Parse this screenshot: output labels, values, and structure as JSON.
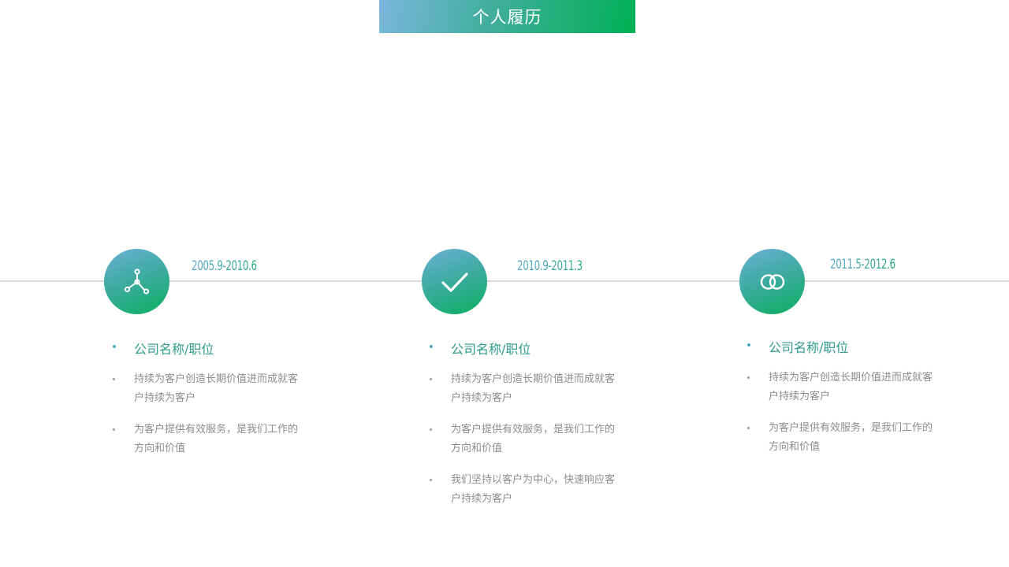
{
  "title": "个人履历",
  "colors": {
    "gradient_start": "#7ab6dd",
    "gradient_end": "#00b054",
    "company_text": "#2f9b8c",
    "body_text": "#8c8c8c",
    "timeline": "#d9d9d9"
  },
  "timeline": [
    {
      "icon": "network-nodes-icon",
      "date": "2005.9-2010.6",
      "company": "公司名称/职位",
      "bullets": [
        "持续为客户创造长期价值进而成就客户持续为客户",
        "为客户提供有效服务，是我们工作的方向和价值"
      ]
    },
    {
      "icon": "checkmark-icon",
      "date": "2010.9-2011.3",
      "company": "公司名称/职位",
      "bullets": [
        "持续为客户创造长期价值进而成就客户持续为客户",
        "为客户提供有效服务，是我们工作的方向和价值",
        "我们坚持以客户为中心，快速响应客户持续为客户"
      ]
    },
    {
      "icon": "linked-rings-icon",
      "date": "2011.5-2012.6",
      "company": "公司名称/职位",
      "bullets": [
        "持续为客户创造长期价值进而成就客户持续为客户",
        "为客户提供有效服务，是我们工作的方向和价值"
      ]
    }
  ]
}
